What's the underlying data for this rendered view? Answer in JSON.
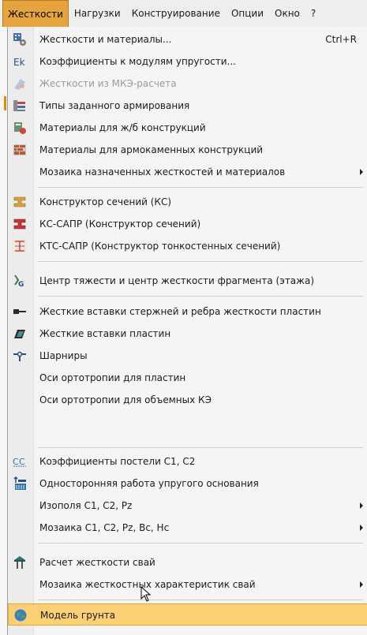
{
  "menubar": {
    "items": [
      "Жесткости",
      "Нагрузки",
      "Конструирование",
      "Опции",
      "Окно",
      "?"
    ],
    "active_color": "#e6a43f"
  },
  "menu": {
    "items": [
      {
        "label": "Жесткости и материалы...",
        "shortcut": "Ctrl+R",
        "icon": "stiffness-materials-icon"
      },
      {
        "label": "Коэффициенты к модулям упругости...",
        "icon": "ek-coefficients-icon"
      },
      {
        "label": "Жесткости из МКЭ-расчета",
        "icon": "fem-stiffness-icon",
        "disabled": true
      },
      {
        "label": "Типы заданного армирования",
        "icon": "reinforcement-types-icon"
      },
      {
        "label": "Материалы для ж/б конструкций",
        "icon": "rc-materials-icon"
      },
      {
        "label": "Материалы для армокаменных конструкций",
        "icon": "masonry-materials-icon"
      },
      {
        "label": "Мозаика назначенных жесткостей и материалов",
        "submenu": true
      },
      {
        "label": "Конструктор сечений (КС)",
        "icon": "section-designer-icon"
      },
      {
        "label": "КС-САПР (Конструктор сечений)",
        "icon": "ks-sapr-icon"
      },
      {
        "label": "КТС-САПР (Конструктор тонкостенных сечений)",
        "icon": "thin-wall-section-icon"
      },
      {
        "label": "Центр тяжести и центр жесткости фрагмента (этажа)",
        "icon": "center-of-gravity-icon"
      },
      {
        "label": "Жесткие вставки стержней и ребра жесткости пластин",
        "icon": "rigid-bar-inserts-icon"
      },
      {
        "label": "Жесткие вставки пластин",
        "icon": "rigid-plate-inserts-icon"
      },
      {
        "label": "Шарниры",
        "icon": "hinge-icon"
      },
      {
        "label": "Оси ортотропии для пластин"
      },
      {
        "label": "Оси ортотропии для объемных КЭ"
      },
      {
        "label": "Коэффициенты постели С1, С2",
        "icon": "subgrade-coefficients-icon"
      },
      {
        "label": "Односторонняя работа упругого основания",
        "icon": "one-way-foundation-icon"
      },
      {
        "label": "Изополя С1, С2, Pz",
        "submenu": true
      },
      {
        "label": "Мозаика С1, С2, Pz, Bc, Hc",
        "submenu": true
      },
      {
        "label": "Расчет жесткости свай",
        "icon": "pile-stiffness-icon"
      },
      {
        "label": "Мозаика жесткостных характеристик свай",
        "submenu": true
      },
      {
        "label": "Модель грунта",
        "icon": "soil-model-globe-icon",
        "highlighted": true
      }
    ]
  }
}
